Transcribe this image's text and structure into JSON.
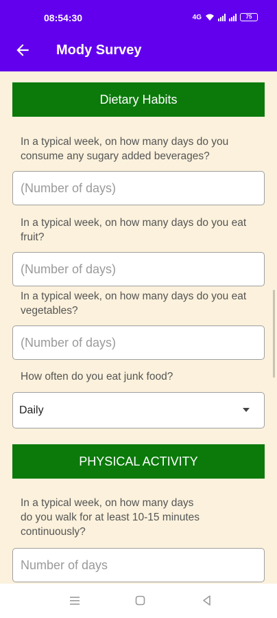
{
  "status_bar": {
    "time": "08:54:30",
    "signal_text": "⁴ᴳ",
    "battery": "75"
  },
  "app_bar": {
    "back_icon": "arrow-left-icon",
    "title": "Mody Survey"
  },
  "sections": {
    "dietary": {
      "header": "Dietary Habits",
      "q1": {
        "question": "In a typical week, on how many days do you consume any sugary added beverages?",
        "placeholder": "(Number of days)"
      },
      "q2": {
        "question": "In a typical week, on how many days do you eat fruit?",
        "placeholder": "(Number of days)"
      },
      "q3": {
        "question": "In a typical week, on how many days do you eat vegetables?",
        "placeholder": "(Number of days)"
      },
      "q4": {
        "question": "How often do you eat junk food?",
        "selected": "Daily"
      }
    },
    "physical": {
      "header": "PHYSICAL ACTIVITY",
      "q1": {
        "question_line1": "In a typical week, on how many days",
        "question_line2": "do you walk for at least 10-15 minutes continuously?",
        "placeholder": "Number of days"
      }
    }
  },
  "nav_bar": {
    "icons": [
      "menu-icon",
      "home-square-icon",
      "back-triangle-icon"
    ]
  },
  "colors": {
    "primary": "#6200ee",
    "section_header": "#0b7a0b",
    "background": "#fbf1dc"
  }
}
